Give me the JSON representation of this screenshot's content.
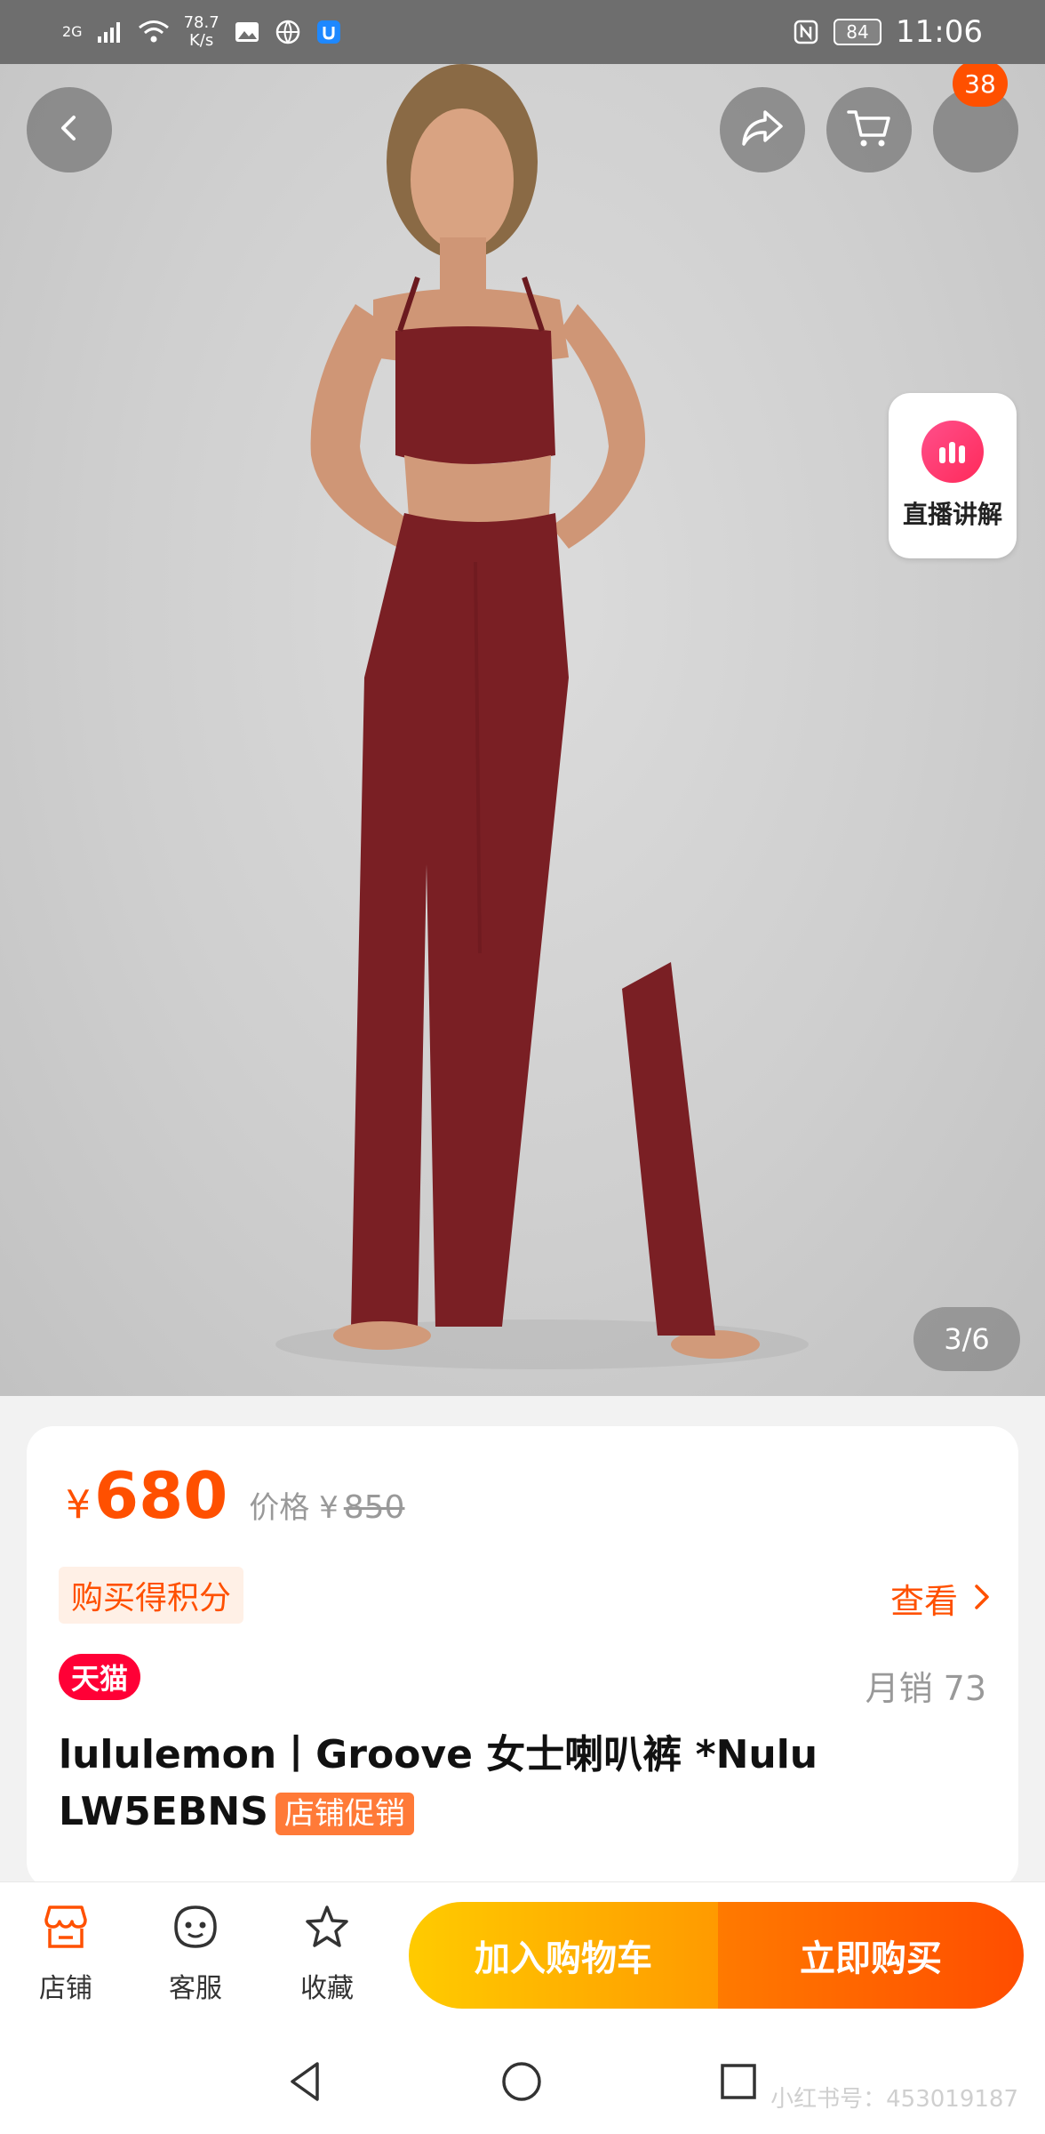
{
  "status_bar": {
    "network": "2G",
    "speed_value": "78.7",
    "speed_unit": "K/s",
    "battery": "84",
    "time": "11:06"
  },
  "header": {
    "back_icon": "chevron-left-icon",
    "share_icon": "share-icon",
    "cart_icon": "cart-icon",
    "more_badge": "38"
  },
  "live": {
    "label": "直播讲解"
  },
  "gallery": {
    "current": 3,
    "total": 6,
    "indicator": "3/6"
  },
  "product": {
    "currency": "¥",
    "price": "680",
    "original_label": "价格 ¥",
    "original_price": "850",
    "points_tag": "购买得积分",
    "view_label": "查看",
    "store_badge": "天猫",
    "monthly_sales": "月销 73",
    "title": "lululemon丨Groove 女士喇叭裤 *Nulu LW5EBNS",
    "promo_tag": "店铺促销"
  },
  "actions": {
    "store": "店铺",
    "service": "客服",
    "favorite": "收藏",
    "add_to_cart": "加入购物车",
    "buy_now": "立即购买"
  },
  "watermark": "小红书号：453019187",
  "colors": {
    "accent": "#ff5000",
    "tmall_red": "#ff0036",
    "cart_yellow": "#ffcb00",
    "buy_orange": "#ff4d00"
  }
}
